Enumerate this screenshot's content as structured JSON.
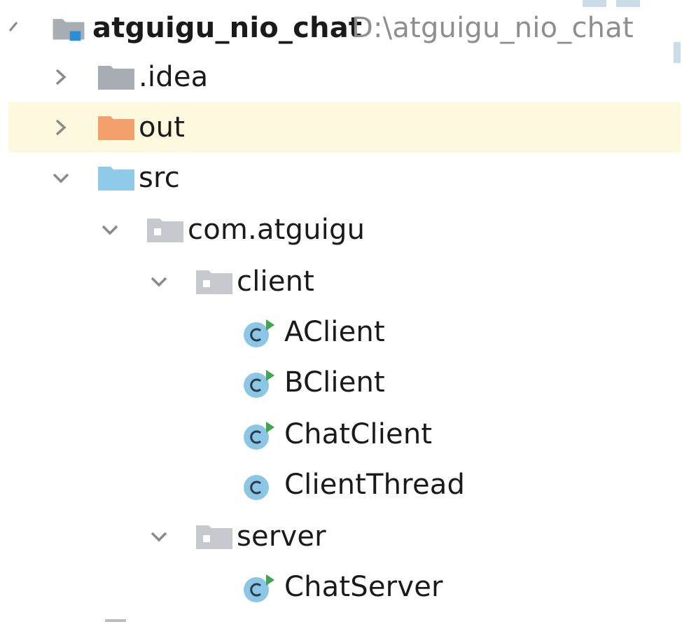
{
  "tree": {
    "root": {
      "name": "atguigu_nio_chat",
      "path": "D:\\atguigu_nio_chat"
    },
    "items": [
      {
        "label": ".idea"
      },
      {
        "label": "out"
      },
      {
        "label": "src"
      },
      {
        "label": "com.atguigu"
      },
      {
        "label": "client"
      },
      {
        "label": "AClient"
      },
      {
        "label": "BClient"
      },
      {
        "label": "ChatClient"
      },
      {
        "label": "ClientThread"
      },
      {
        "label": "server"
      },
      {
        "label": "ChatServer"
      }
    ]
  },
  "icons": {
    "root": "module-folder-icon",
    "idea": "settings-folder-icon",
    "out": "excluded-folder-icon",
    "src": "source-folder-icon",
    "package": "package-icon",
    "class": "class-icon",
    "runnable_class": "runnable-class-icon"
  },
  "colors": {
    "selected_row": "#fcf9df",
    "folder_gray": "#a8adb3",
    "folder_orange": "#f4a06c",
    "folder_blue": "#8fcbe9",
    "package_gray": "#c5c9cd",
    "class_circle": "#8bc6e6",
    "run_badge": "#3ea650",
    "module_square": "#2b8fd6",
    "path_text": "#8e8e8e"
  }
}
